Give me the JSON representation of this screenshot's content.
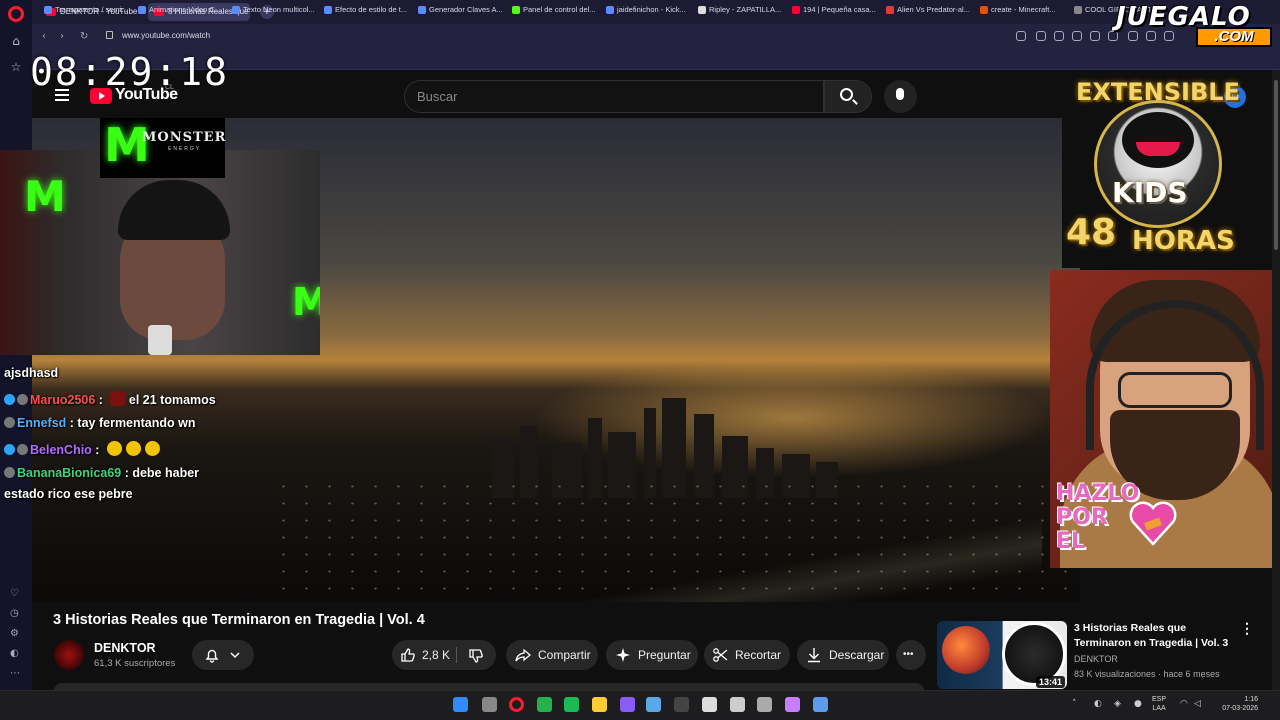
{
  "browser": {
    "tabs": [
      {
        "label": "DENKTOR - YouTube"
      },
      {
        "label": "3 Historias Reales que Ter"
      }
    ],
    "new_tab_label": "+",
    "url": "www.youtube.com/watch",
    "bookmarks": [
      {
        "label": "Transparenta / semi..."
      },
      {
        "label": "Animations Video C..."
      },
      {
        "label": "Texto Neon multicol..."
      },
      {
        "label": "Efecto de estilo de t..."
      },
      {
        "label": "Generador Claves A..."
      },
      {
        "label": "Panel de control del..."
      },
      {
        "label": "jaidefinichon - Kick..."
      },
      {
        "label": "Ripley - ZAPATILLA..."
      },
      {
        "label": "194 | Pequeña casa..."
      },
      {
        "label": "Alien Vs Predator-al..."
      },
      {
        "label": "create - Minecraft..."
      },
      {
        "label": "COOL GIRLD JAAJ |..."
      }
    ]
  },
  "overlay": {
    "clock": "08:29:18",
    "chat": [
      {
        "user": "",
        "user_color": "#ffffff",
        "text": "ajsdhasd"
      },
      {
        "user": "Maruo2506",
        "user_color": "#ff4d4d",
        "text": "el 21 tomamos"
      },
      {
        "user": "Ennefsd",
        "user_color": "#4fb0ff",
        "text": "tay fermentando wn"
      },
      {
        "user": "BelenChio",
        "user_color": "#b36bff",
        "text": ""
      },
      {
        "user": "BananaBionica69",
        "user_color": "#3fd47a",
        "text": "debe haber"
      },
      {
        "user": "",
        "user_color": "#ffffff",
        "text": "estado rico ese pebre"
      }
    ],
    "monster_word": "MONSTER",
    "monster_sub": "ENERGY",
    "juegalo_top": "JUEGALO",
    "juegalo_bottom": ".COM",
    "extensible": "EXTENSIBLE",
    "kids": "KIDS",
    "hours_num": "48",
    "hours_word": "HORAS",
    "hazlo_lines": [
      "HAZLO",
      "POR",
      "EL"
    ]
  },
  "youtube": {
    "logo": "YouTube",
    "country": "CL",
    "search_placeholder": "Buscar",
    "avatar_letter": "D",
    "video_title": "3 Historias Reales que Terminaron en Tragedia | Vol. 4",
    "channel": "DENKTOR",
    "subscribers": "61,3 K suscriptores",
    "likes": "2,8 K",
    "share": "Compartir",
    "ask": "Preguntar",
    "clip": "Recortar",
    "download": "Descargar",
    "more": "•••",
    "recommendation": {
      "title": "3 Historias Reales que Terminaron en Tragedia | Vol. 3",
      "channel": "DENKTOR",
      "meta": "83 K visualizaciones · hace 6 meses",
      "duration": "13:41"
    }
  },
  "taskbar": {
    "lang_1": "ESP",
    "lang_2": "LAA",
    "time": "1:16",
    "date": "07-03-2026",
    "icon_colors": [
      "#2f8bff",
      "#888888",
      "#ff1b2d",
      "#22b14c",
      "#1db954",
      "#ffcc33",
      "#8a5cf6",
      "#5aa9e6",
      "#444444",
      "#dddddd",
      "#cccccc",
      "#aaaaaa",
      "#c77dff",
      "#5d9cec"
    ]
  }
}
